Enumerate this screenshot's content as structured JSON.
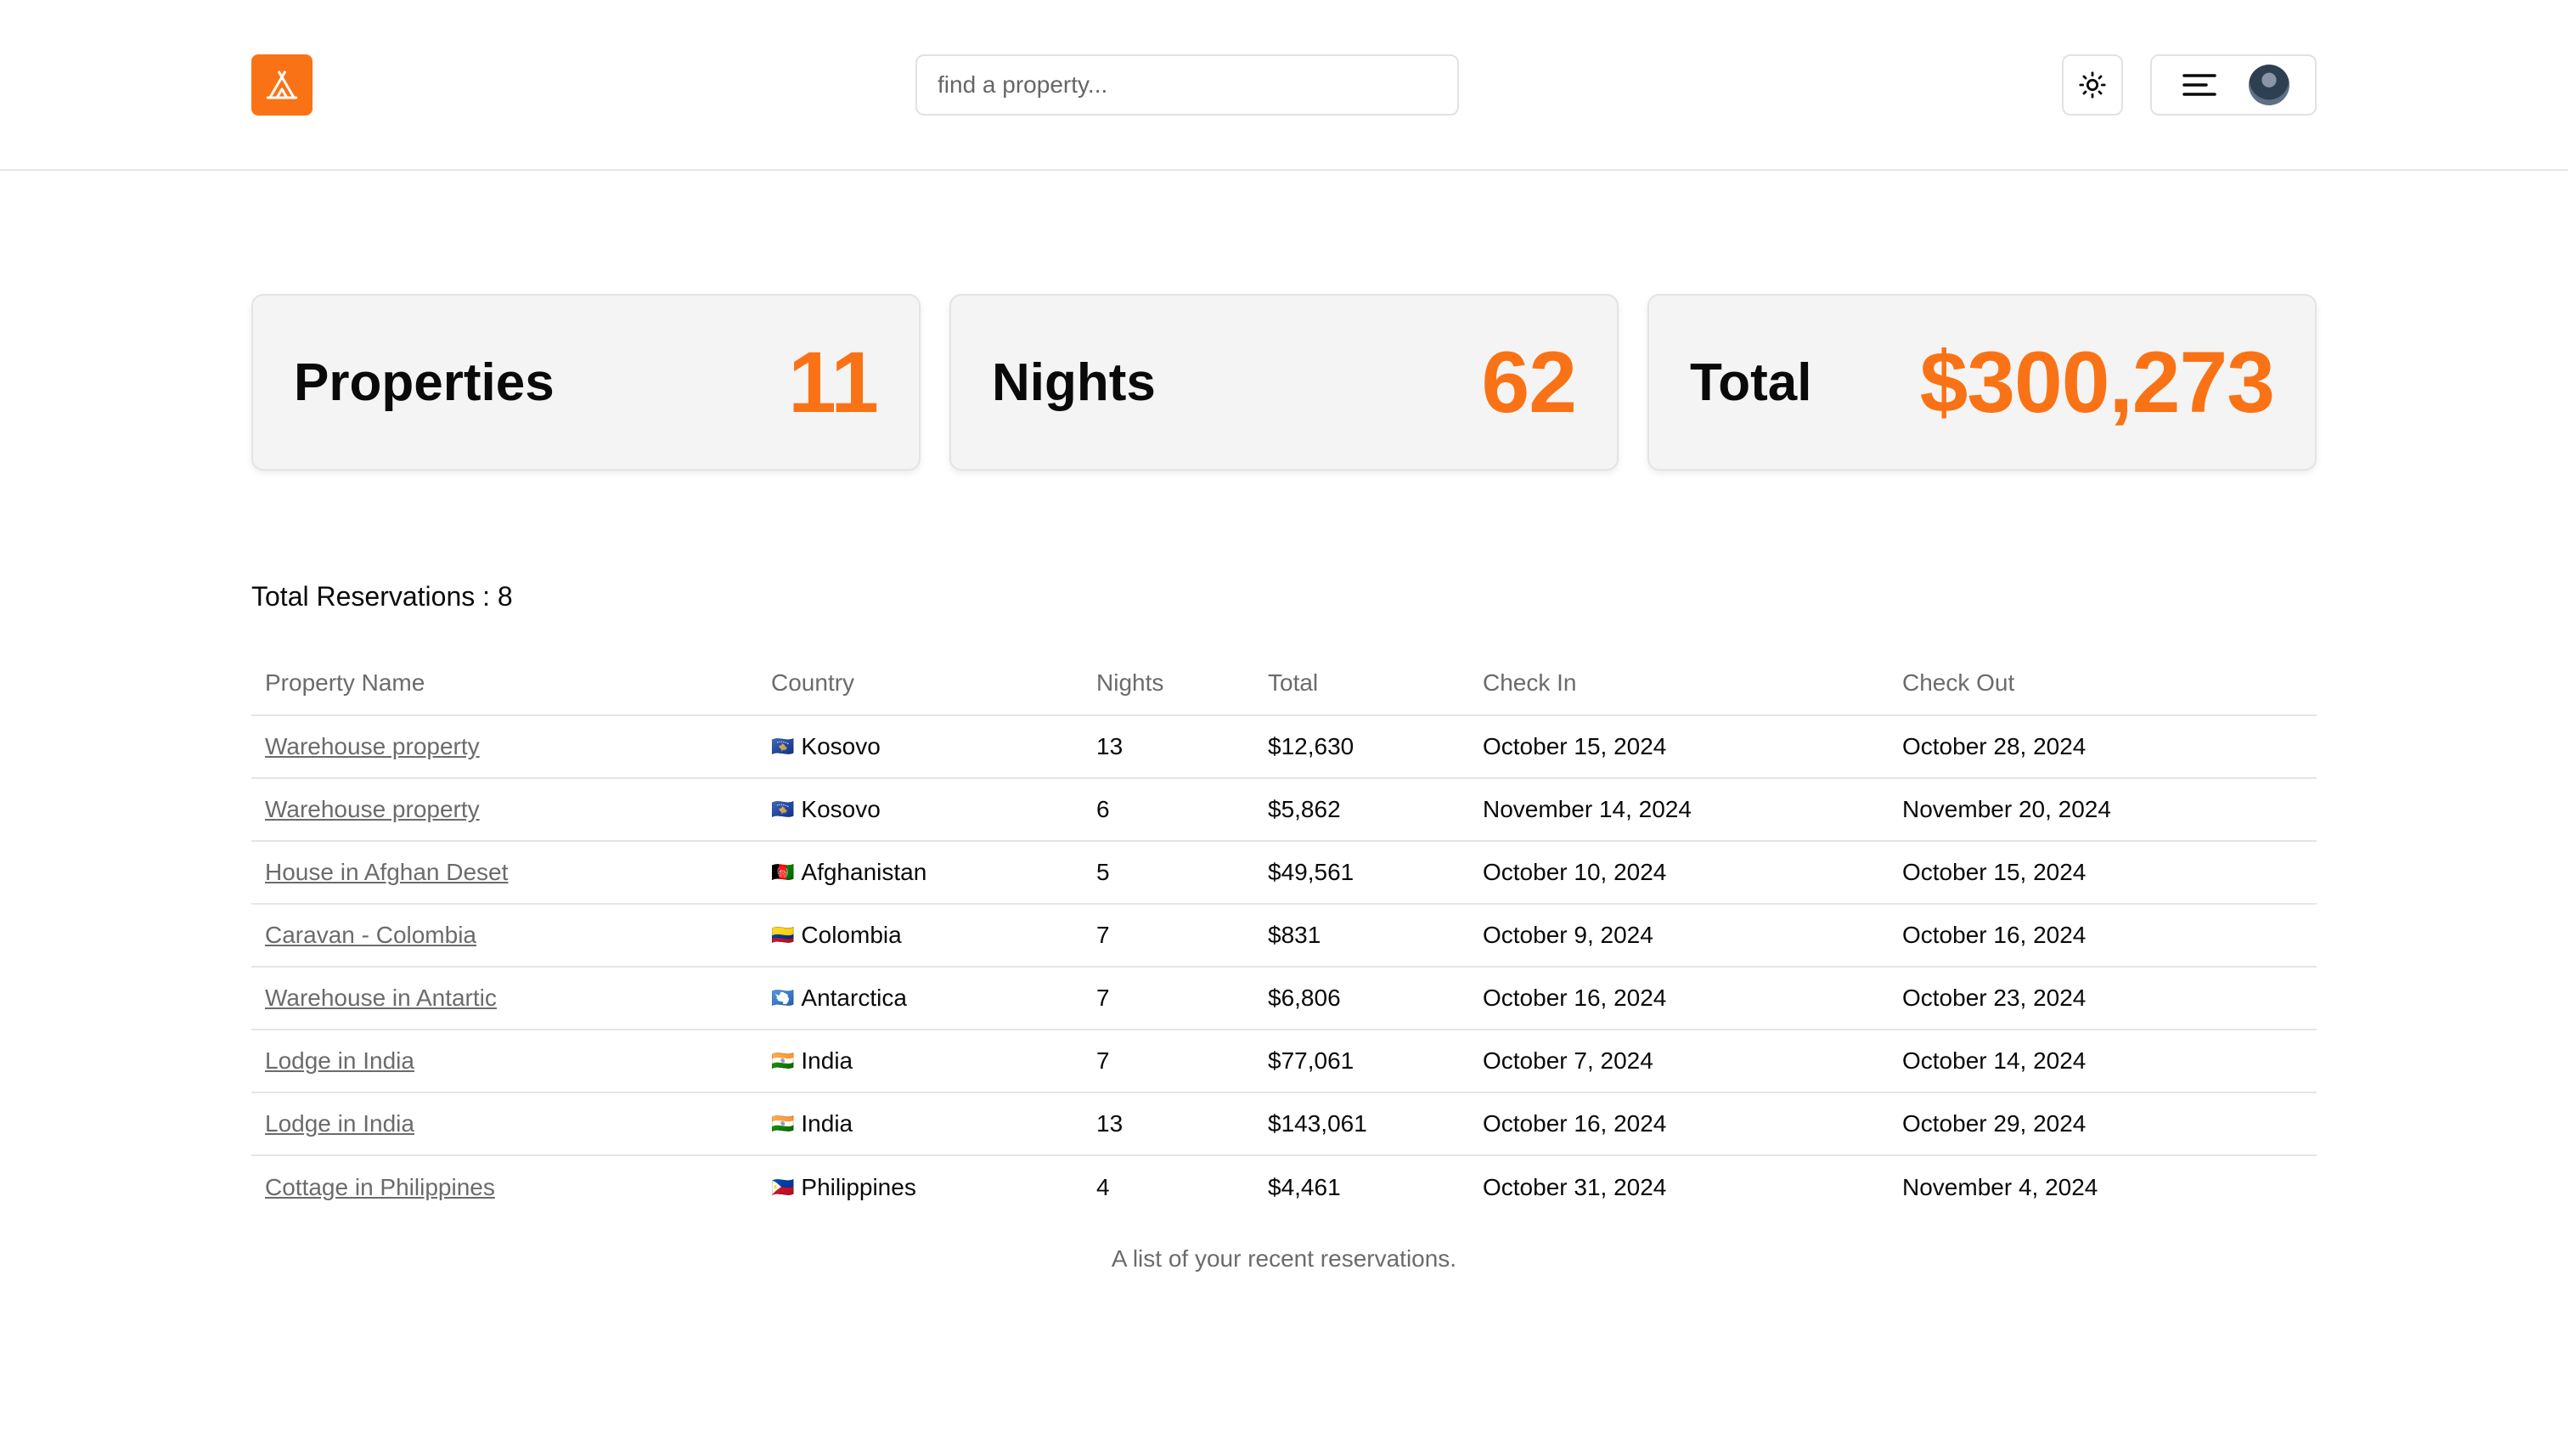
{
  "header": {
    "search_placeholder": "find a property...",
    "logo_icon": "tent-icon",
    "theme_icon": "sun-icon",
    "menu_icon": "menu-icon",
    "brand_color": "#f97316"
  },
  "stats": [
    {
      "label": "Properties",
      "value": "11"
    },
    {
      "label": "Nights",
      "value": "62"
    },
    {
      "label": "Total",
      "value": "$300,273"
    }
  ],
  "reservations": {
    "summary": "Total Reservations : 8",
    "columns": [
      "Property Name",
      "Country",
      "Nights",
      "Total",
      "Check In",
      "Check Out"
    ],
    "rows": [
      {
        "name": "Warehouse property",
        "flag": "🇽🇰",
        "country": "Kosovo",
        "nights": "13",
        "total": "$12,630",
        "check_in": "October 15, 2024",
        "check_out": "October 28, 2024"
      },
      {
        "name": "Warehouse property",
        "flag": "🇽🇰",
        "country": "Kosovo",
        "nights": "6",
        "total": "$5,862",
        "check_in": "November 14, 2024",
        "check_out": "November 20, 2024"
      },
      {
        "name": "House in Afghan Deset",
        "flag": "🇦🇫",
        "country": "Afghanistan",
        "nights": "5",
        "total": "$49,561",
        "check_in": "October 10, 2024",
        "check_out": "October 15, 2024"
      },
      {
        "name": "Caravan - Colombia",
        "flag": "🇨🇴",
        "country": "Colombia",
        "nights": "7",
        "total": "$831",
        "check_in": "October 9, 2024",
        "check_out": "October 16, 2024"
      },
      {
        "name": "Warehouse in Antartic",
        "flag": "🇦🇶",
        "country": "Antarctica",
        "nights": "7",
        "total": "$6,806",
        "check_in": "October 16, 2024",
        "check_out": "October 23, 2024"
      },
      {
        "name": "Lodge in India",
        "flag": "🇮🇳",
        "country": "India",
        "nights": "7",
        "total": "$77,061",
        "check_in": "October 7, 2024",
        "check_out": "October 14, 2024"
      },
      {
        "name": "Lodge in India",
        "flag": "🇮🇳",
        "country": "India",
        "nights": "13",
        "total": "$143,061",
        "check_in": "October 16, 2024",
        "check_out": "October 29, 2024"
      },
      {
        "name": "Cottage in Philippines",
        "flag": "🇵🇭",
        "country": "Philippines",
        "nights": "4",
        "total": "$4,461",
        "check_in": "October 31, 2024",
        "check_out": "November 4, 2024"
      }
    ],
    "caption": "A list of your recent reservations."
  }
}
